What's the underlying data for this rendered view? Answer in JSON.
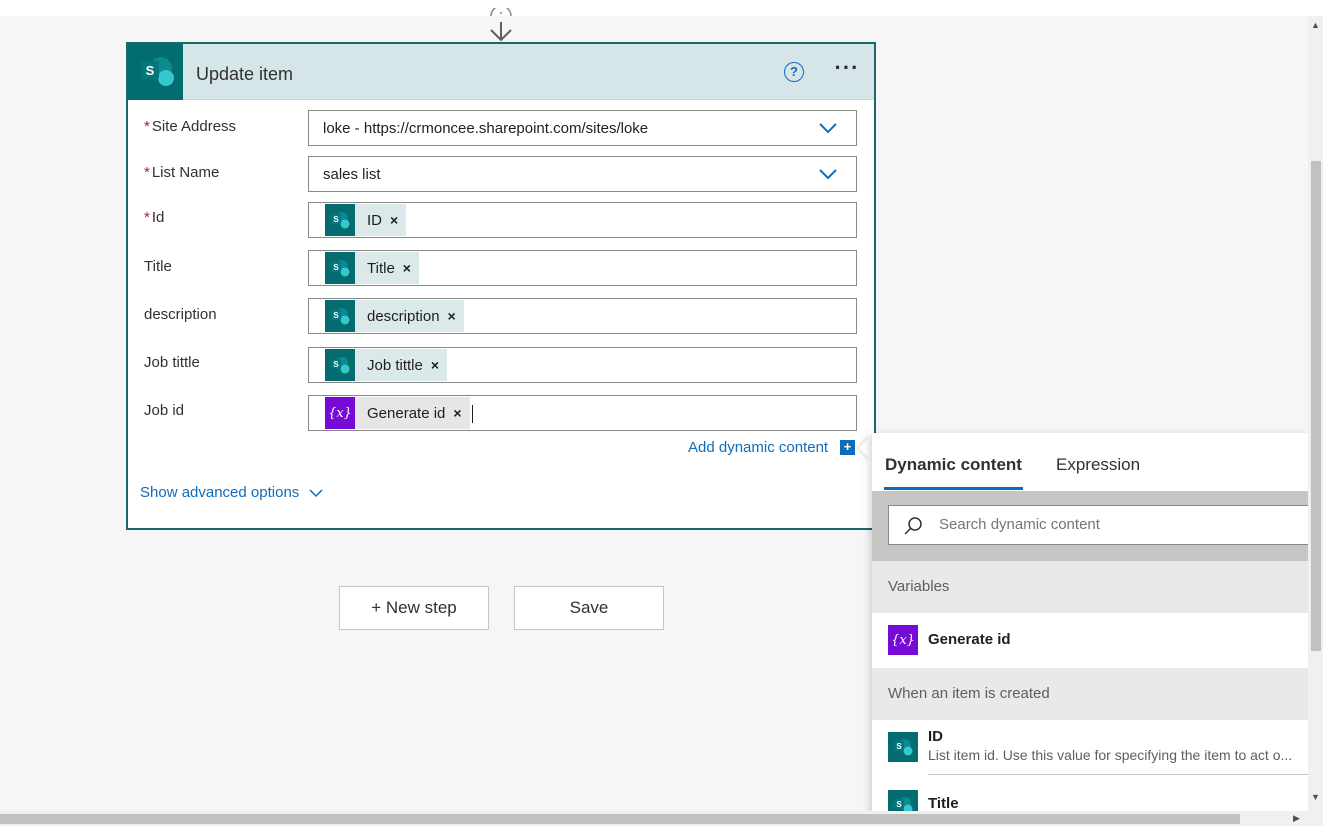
{
  "card": {
    "title": "Update item",
    "help_icon": "question-icon",
    "more_icon": "ellipsis-icon",
    "fields": [
      {
        "label": "Site Address",
        "required": true,
        "type": "dropdown",
        "value": "loke - https://crmoncee.sharepoint.com/sites/loke"
      },
      {
        "label": "List Name",
        "required": true,
        "type": "dropdown",
        "value": "sales list"
      },
      {
        "label": "Id",
        "required": true,
        "type": "token",
        "token": "ID",
        "token_icon": "sharepoint-icon"
      },
      {
        "label": "Title",
        "required": false,
        "type": "token",
        "token": "Title",
        "token_icon": "sharepoint-icon"
      },
      {
        "label": "description",
        "required": false,
        "type": "token",
        "token": "description",
        "token_icon": "sharepoint-icon"
      },
      {
        "label": "Job tittle",
        "required": false,
        "type": "token",
        "token": "Job tittle",
        "token_icon": "sharepoint-icon"
      },
      {
        "label": "Job id",
        "required": false,
        "type": "token",
        "token": "Generate id",
        "token_icon": "variable-icon"
      }
    ],
    "required_marker": "*",
    "token_remove": "×",
    "add_dynamic_label": "Add dynamic content",
    "add_dynamic_plus": "+",
    "advanced_label": "Show advanced options"
  },
  "buttons": {
    "new_step": "+ New step",
    "save": "Save"
  },
  "dynamic_panel": {
    "tabs": [
      "Dynamic content",
      "Expression"
    ],
    "active_tab": "Dynamic content",
    "search_placeholder": "Search dynamic content",
    "sections": [
      {
        "title": "Variables",
        "items": [
          {
            "title": "Generate id",
            "icon": "variable-icon"
          }
        ]
      },
      {
        "title": "When an item is created",
        "items": [
          {
            "title": "ID",
            "desc": "List item id. Use this value for specifying the item to act o...",
            "icon": "sharepoint-icon"
          },
          {
            "title": "Title",
            "icon": "sharepoint-icon"
          }
        ]
      }
    ]
  },
  "var_glyph": "{x}",
  "colors": {
    "sharepoint_teal": "#036c70",
    "accent_blue": "#0f6cbd",
    "variable_purple": "#770bd6",
    "card_border": "#1b6770"
  }
}
